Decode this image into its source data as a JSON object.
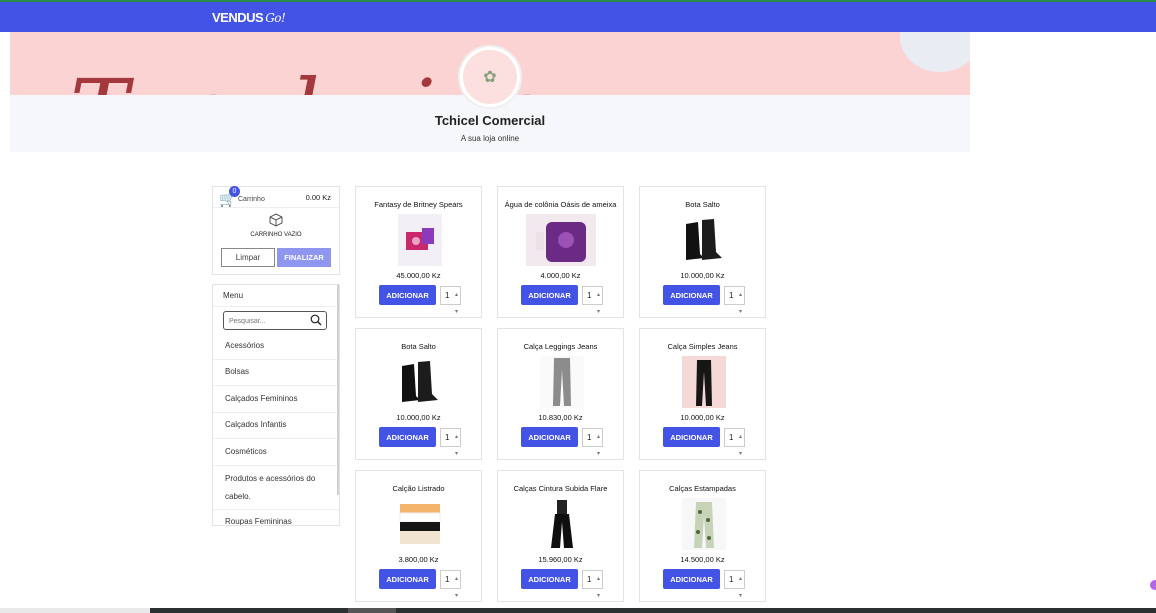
{
  "app": {
    "logo_text": "VENDUS",
    "logo_suffix": "Go!"
  },
  "store": {
    "name": "Tchicel Comercial",
    "tagline": "A sua loja online"
  },
  "cart": {
    "badge_count": "0",
    "label": "Carrinho",
    "total": "0.00 Kz",
    "empty_text": "CARRINHO VAZIO",
    "clear_label": "Limpar",
    "finish_label": "FINALIZAR"
  },
  "menu": {
    "title": "Menu",
    "search_placeholder": "Pesquisar...",
    "items": [
      "Acessórios",
      "Bolsas",
      "Calçados Femininos",
      "Calçados Infantis",
      "Cosméticos",
      "Produtos e acessórios do cabelo.",
      "Roupas Femininas"
    ]
  },
  "products": [
    {
      "name": "Fantasy de Britney Spears",
      "price": "45.000,00 Kz",
      "button": "ADICIONAR",
      "qty": "1",
      "thumb": "perfume-box"
    },
    {
      "name": "Água de colônia Oásis de ameixa",
      "price": "4.000,00 Kz",
      "button": "ADICIONAR",
      "qty": "1",
      "thumb": "cologne-bottle"
    },
    {
      "name": "Bota Salto",
      "price": "10.000,00 Kz",
      "button": "ADICIONAR",
      "qty": "1",
      "thumb": "boots"
    },
    {
      "name": "Bota Salto",
      "price": "10.000,00 Kz",
      "button": "ADICIONAR",
      "qty": "1",
      "thumb": "boots"
    },
    {
      "name": "Calça Leggings Jeans",
      "price": "10.830,00 Kz",
      "button": "ADICIONAR",
      "qty": "1",
      "thumb": "grey-jeans"
    },
    {
      "name": "Calça Simples Jeans",
      "price": "10.000,00 Kz",
      "button": "ADICIONAR",
      "qty": "1",
      "thumb": "black-jeans"
    },
    {
      "name": "Calção Listrado",
      "price": "3.800,00 Kz",
      "button": "ADICIONAR",
      "qty": "1",
      "thumb": "striped-shorts"
    },
    {
      "name": "Calças Cintura Subida Flare",
      "price": "15.960,00 Kz",
      "button": "ADICIONAR",
      "qty": "1",
      "thumb": "flare-pants"
    },
    {
      "name": "Calças Estampadas",
      "price": "14.500,00 Kz",
      "button": "ADICIONAR",
      "qty": "1",
      "thumb": "printed-pants"
    }
  ],
  "colors": {
    "accent": "#4353e6",
    "accent_light": "#8f96ef",
    "banner_pink": "#fbd3d3",
    "script_red": "#a3393d"
  }
}
